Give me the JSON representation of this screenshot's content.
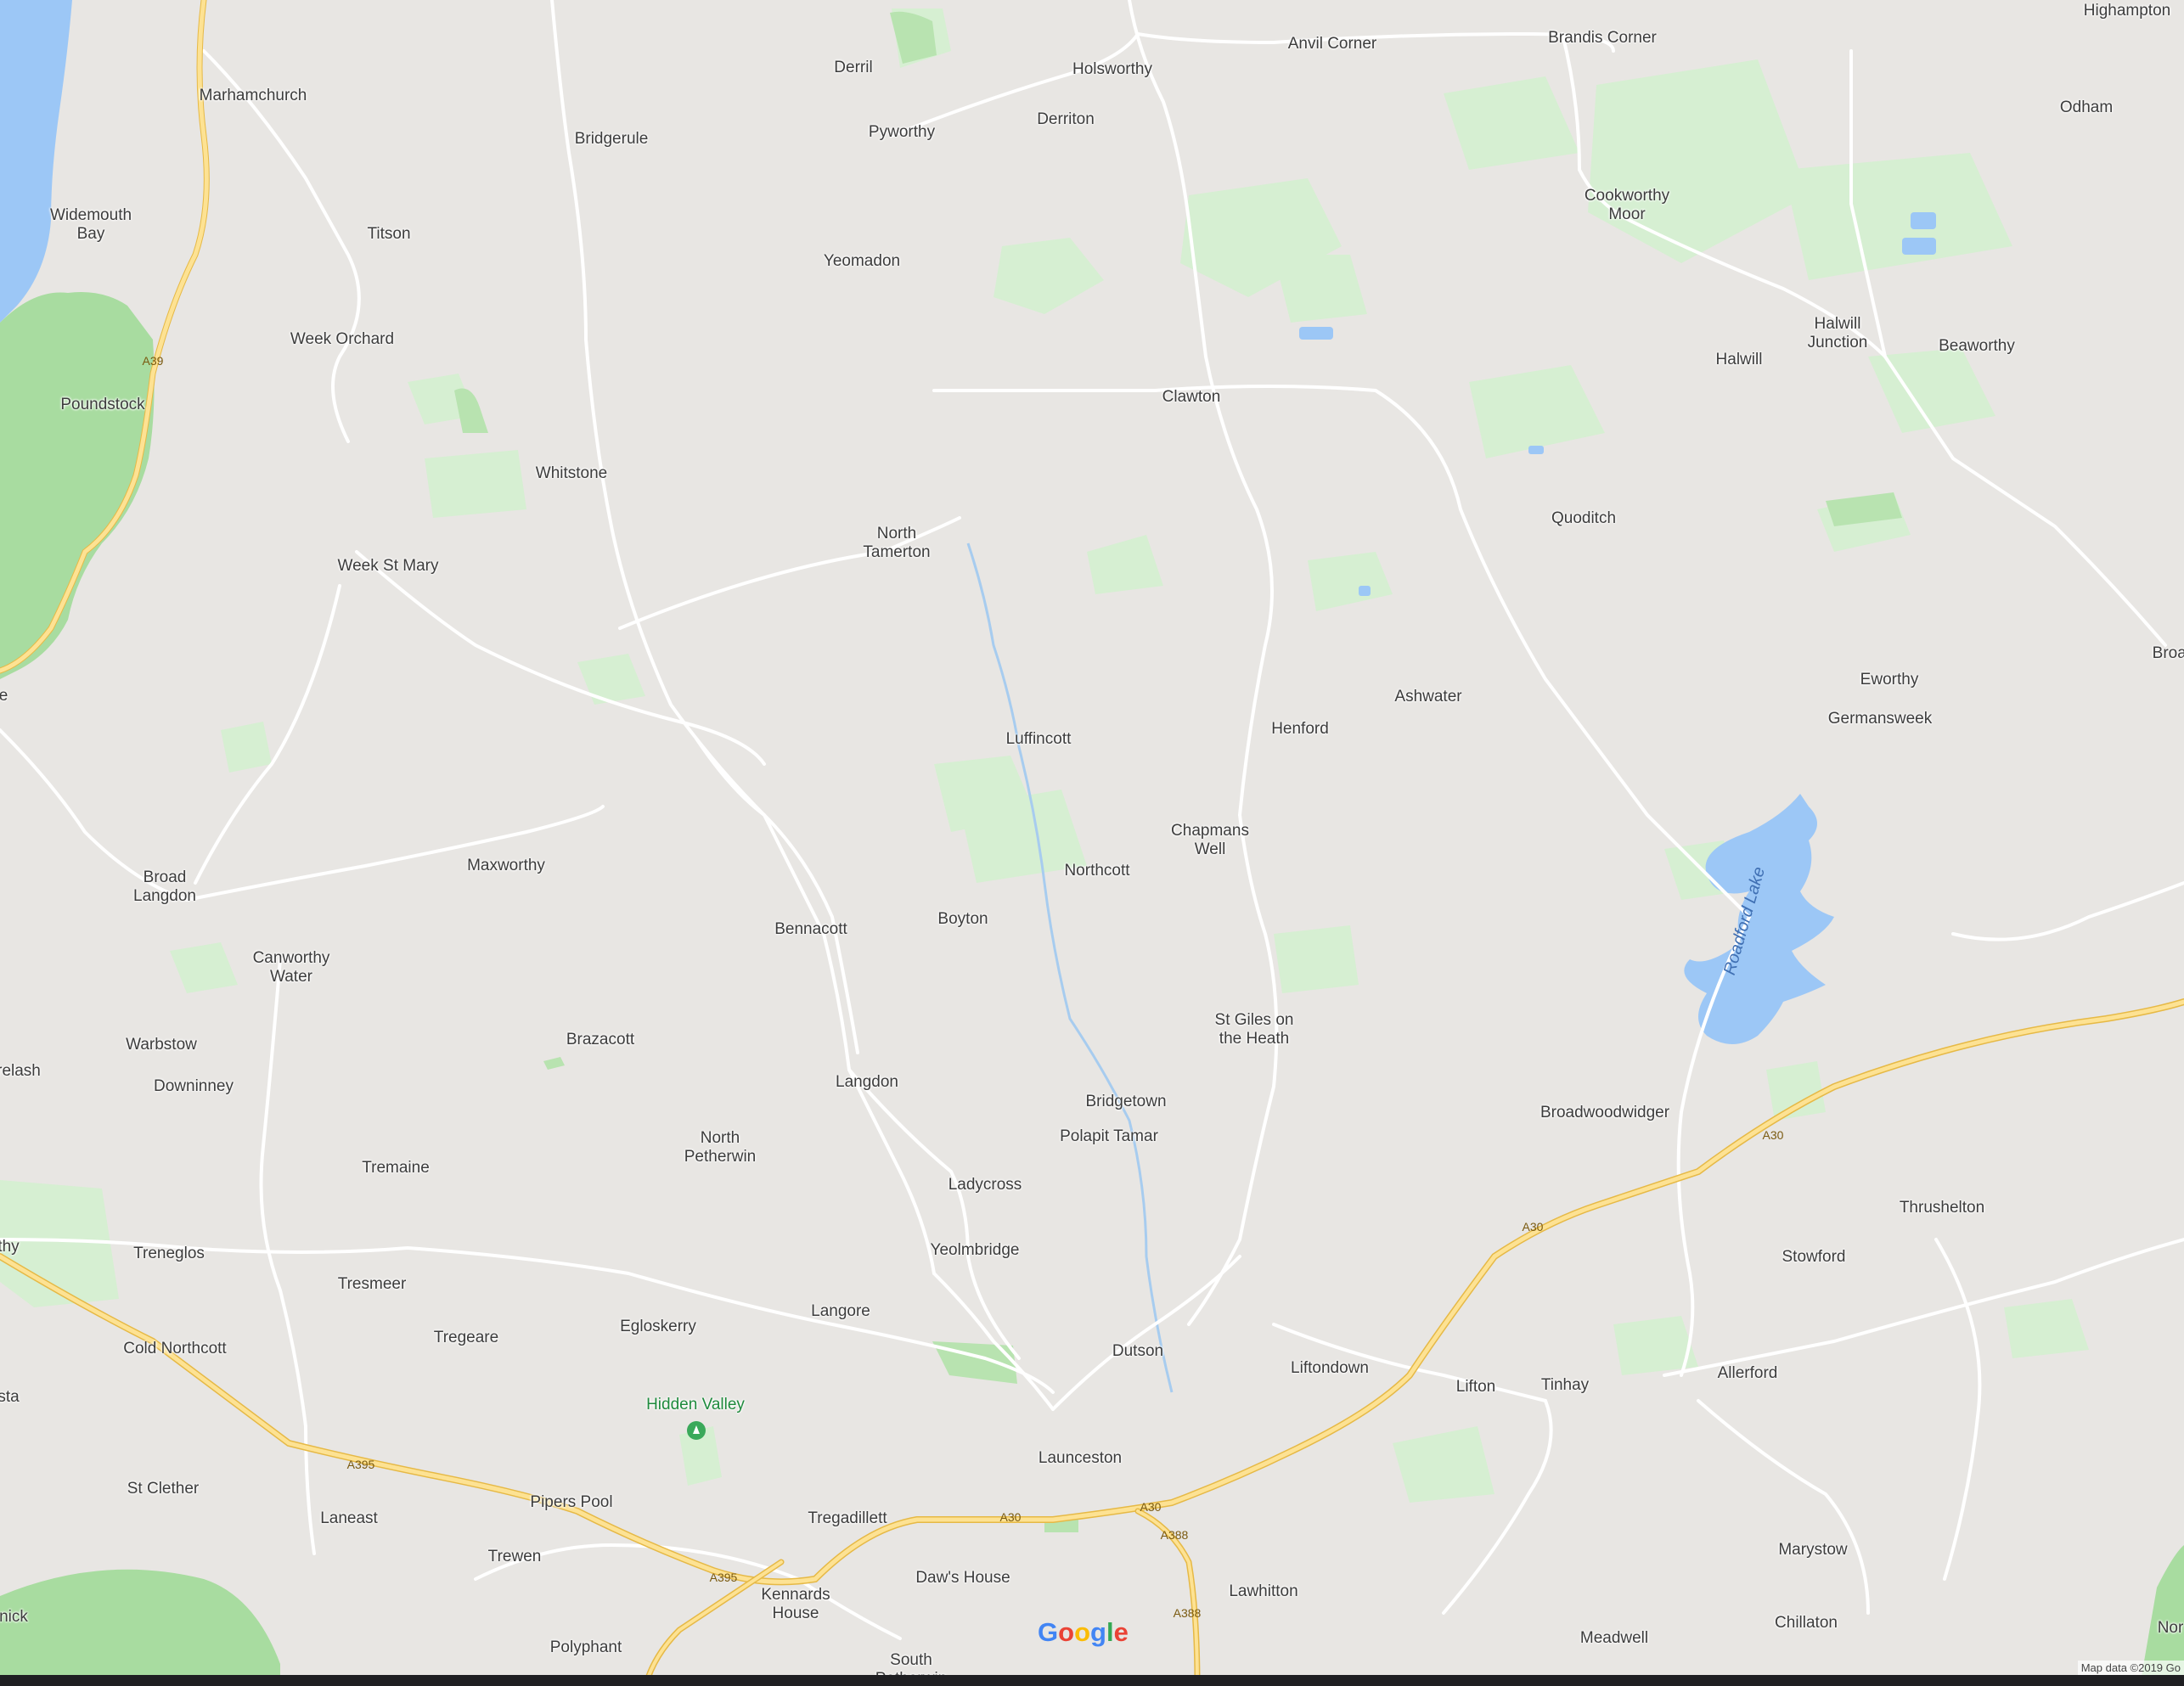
{
  "map": {
    "colors": {
      "land": "#e8e6e3",
      "park": "#d6efd2",
      "forest": "#a8dca0",
      "water": "#9cc7f6",
      "road": "#ffffff",
      "primary_road": "#fbd96a"
    },
    "places": [
      {
        "name": "Marhamchurch"
      },
      {
        "name": "Widemouth\nBay"
      },
      {
        "name": "Titson"
      },
      {
        "name": "Bridgerule"
      },
      {
        "name": "Derril"
      },
      {
        "name": "Pyworthy"
      },
      {
        "name": "Holsworthy"
      },
      {
        "name": "Derriton"
      },
      {
        "name": "Anvil Corner"
      },
      {
        "name": "Brandis Corner"
      },
      {
        "name": "Highampton"
      },
      {
        "name": "Odham"
      },
      {
        "name": "Cookworthy\nMoor"
      },
      {
        "name": "Halwill\nJunction"
      },
      {
        "name": "Halwill"
      },
      {
        "name": "Beaworthy"
      },
      {
        "name": "Yeomadon"
      },
      {
        "name": "Week Orchard"
      },
      {
        "name": "Poundstock"
      },
      {
        "name": "Whitstone"
      },
      {
        "name": "Clawton"
      },
      {
        "name": "Quoditch"
      },
      {
        "name": "North\nTamerton"
      },
      {
        "name": "Week St Mary"
      },
      {
        "name": "Broad"
      },
      {
        "name": "Eworthy"
      },
      {
        "name": "Germansweek"
      },
      {
        "name": "Ashwater"
      },
      {
        "name": "Henford"
      },
      {
        "name": "Luffincott"
      },
      {
        "name": "Chapmans\nWell"
      },
      {
        "name": "Northcott"
      },
      {
        "name": "Maxworthy"
      },
      {
        "name": "Broad\nLangdon"
      },
      {
        "name": "Bennacott"
      },
      {
        "name": "Boyton"
      },
      {
        "name": "Canworthy\nWater"
      },
      {
        "name": "St Giles on\nthe Heath"
      },
      {
        "name": "Warbstow"
      },
      {
        "name": "Brazacott"
      },
      {
        "name": "relash"
      },
      {
        "name": "Downinney"
      },
      {
        "name": "Langdon"
      },
      {
        "name": "Bridgetown"
      },
      {
        "name": "Broadwoodwidger"
      },
      {
        "name": "Polapit Tamar"
      },
      {
        "name": "North\nPetherwin"
      },
      {
        "name": "Tremaine"
      },
      {
        "name": "Ladycross"
      },
      {
        "name": "Thrushelton"
      },
      {
        "name": "thy"
      },
      {
        "name": "Treneglos"
      },
      {
        "name": "Yeolmbridge"
      },
      {
        "name": "Stowford"
      },
      {
        "name": "Tresmeer"
      },
      {
        "name": "Langore"
      },
      {
        "name": "Egloskerry"
      },
      {
        "name": "Tregeare"
      },
      {
        "name": "Cold Northcott"
      },
      {
        "name": "Dutson"
      },
      {
        "name": "Liftondown"
      },
      {
        "name": "Allerford"
      },
      {
        "name": "Lifton"
      },
      {
        "name": "Tinhay"
      },
      {
        "name": "sta"
      },
      {
        "name": "Hidden Valley"
      },
      {
        "name": "Launceston"
      },
      {
        "name": "St Clether"
      },
      {
        "name": "Pipers Pool"
      },
      {
        "name": "Laneast"
      },
      {
        "name": "Tregadillett"
      },
      {
        "name": "Marystow"
      },
      {
        "name": "Trewen"
      },
      {
        "name": "Kennards\nHouse"
      },
      {
        "name": "Daw's House"
      },
      {
        "name": "Lawhitton"
      },
      {
        "name": "nick"
      },
      {
        "name": "Polyphant"
      },
      {
        "name": "Meadwell"
      },
      {
        "name": "Chillaton"
      },
      {
        "name": "South\nPetherwin"
      },
      {
        "name": "Nor"
      },
      {
        "name": "e"
      }
    ],
    "lake_label": "Roadford Lake",
    "road_shields": [
      "A39",
      "A395",
      "A395",
      "A30",
      "A30",
      "A30",
      "A30",
      "A388",
      "A388"
    ],
    "google_logo": {
      "text": "Google",
      "letters": [
        {
          "ch": "G",
          "color": "#4285f4"
        },
        {
          "ch": "o",
          "color": "#ea4335"
        },
        {
          "ch": "o",
          "color": "#fbbc05"
        },
        {
          "ch": "g",
          "color": "#4285f4"
        },
        {
          "ch": "l",
          "color": "#34a853"
        },
        {
          "ch": "e",
          "color": "#ea4335"
        }
      ]
    },
    "attribution": "Map data ©2019 Go"
  }
}
